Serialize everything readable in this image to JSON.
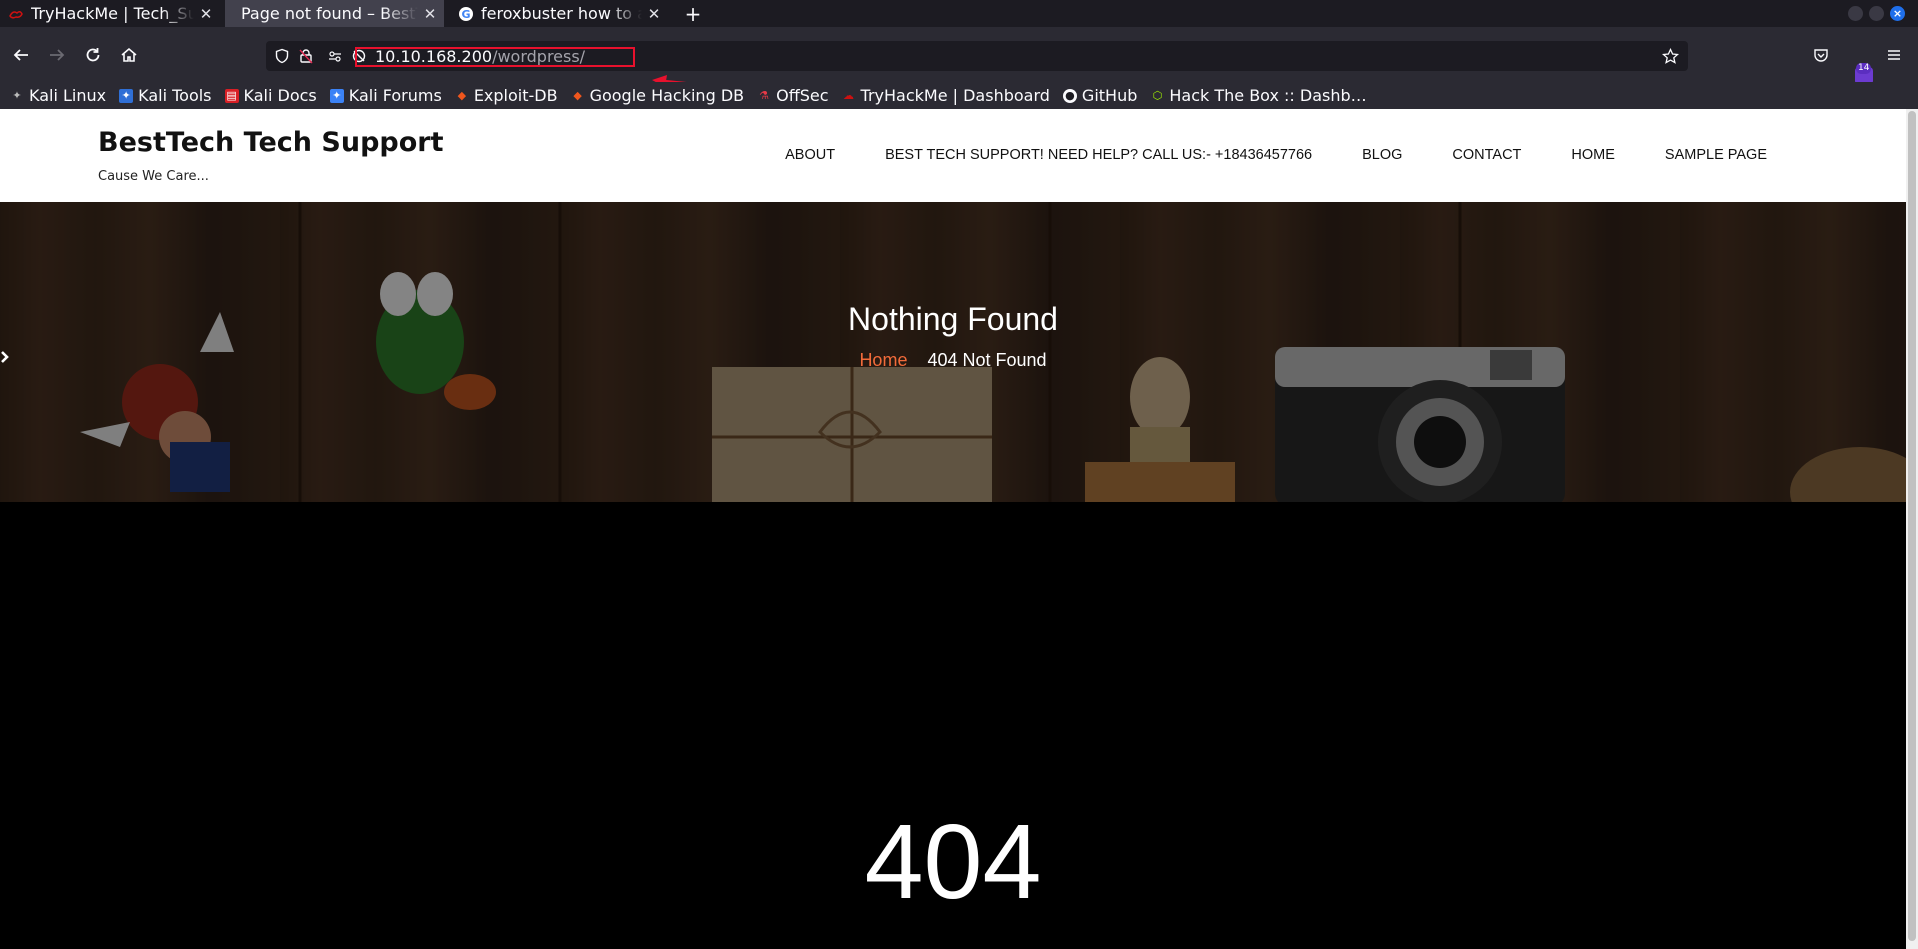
{
  "browser": {
    "tabs": [
      {
        "title": "TryHackMe | Tech_Supp",
        "active": false
      },
      {
        "title": "Page not found – BestTech",
        "active": true
      },
      {
        "title": "feroxbuster how to avoi",
        "active": false
      }
    ],
    "new_tab": "+",
    "url_host": "10.10.168.200",
    "url_path": "/wordpress/",
    "bookmarks": [
      {
        "label": "Kali Linux",
        "icon": "kali-icon"
      },
      {
        "label": "Kali Tools",
        "icon": "kali-tools-icon"
      },
      {
        "label": "Kali Docs",
        "icon": "kali-docs-icon"
      },
      {
        "label": "Kali Forums",
        "icon": "kali-forums-icon"
      },
      {
        "label": "Exploit-DB",
        "icon": "exploitdb-icon"
      },
      {
        "label": "Google Hacking DB",
        "icon": "ghdb-icon"
      },
      {
        "label": "OffSec",
        "icon": "offsec-icon"
      },
      {
        "label": "TryHackMe | Dashboard",
        "icon": "tryhackme-icon"
      },
      {
        "label": "GitHub",
        "icon": "github-icon"
      },
      {
        "label": "Hack The Box :: Dashb…",
        "icon": "hackthebox-icon"
      }
    ],
    "extension_count": "14",
    "colors": {
      "annotation_red": "#e8112d",
      "accent_orange": "#f26b3a"
    }
  },
  "site": {
    "title": "BestTech Tech Support",
    "tagline": "Cause We Care...",
    "nav": [
      "ABOUT",
      "BEST TECH SUPPORT! NEED HELP? CALL US:- +18436457766",
      "BLOG",
      "CONTACT",
      "HOME",
      "SAMPLE PAGE"
    ]
  },
  "hero": {
    "title": "Nothing Found",
    "breadcrumb_home": "Home",
    "breadcrumb_current": "404 Not Found"
  },
  "content": {
    "code": "404"
  }
}
